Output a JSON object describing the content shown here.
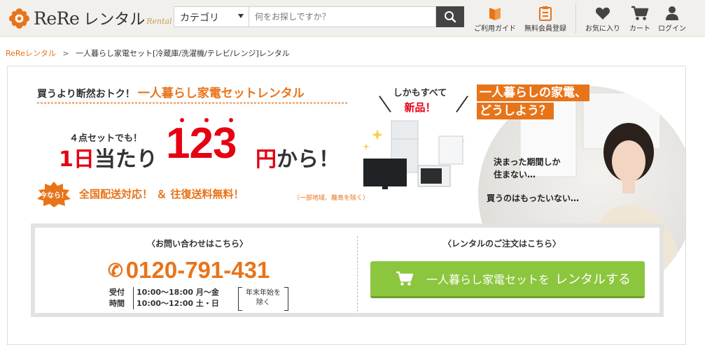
{
  "header": {
    "logo_text": "ReRe",
    "logo_text2": "レンタル",
    "logo_script": "Rental",
    "search": {
      "category_value": "カテゴリ",
      "placeholder": "何をお探しですか？"
    },
    "nav": [
      {
        "label": "ご利用ガイド",
        "icon": "guide-book-icon"
      },
      {
        "label": "無料会員登録",
        "icon": "clipboard-icon"
      },
      {
        "label": "お気に入り",
        "icon": "heart-icon"
      },
      {
        "label": "カート",
        "icon": "cart-icon"
      },
      {
        "label": "ログイン",
        "icon": "user-icon"
      }
    ]
  },
  "breadcrumb": {
    "home": "ReReレンタル",
    "separator": ">",
    "current": "一人暮らし家電セット[冷蔵庫/洗濯機/テレビ/レンジ]レンタル"
  },
  "hero": {
    "tagline": "買うより断然おトク！",
    "tagline_accent": "一人暮らし家電セットレンタル",
    "set_count": "４点セットでも！",
    "per_day_1": "1日",
    "per_day_2": "当たり",
    "price": "123",
    "yen": "円",
    "kara": "から！",
    "now_badge": "今なら！",
    "shipping": "全国配送対応！ ＆ 往復送料無料！",
    "shipping_note": "（一部地域、離島を除く）",
    "bubble_line1": "しかもすべて",
    "bubble_line2": "新品！",
    "question_line1": "一人暮らしの家電、",
    "question_line2": "どうしよう？",
    "worry_line1": "決まった期間しか",
    "worry_line2": "住まない…",
    "worry_line3": "買うのはもったいない…"
  },
  "contact": {
    "inquiry_heading": "〈お問い合わせはこちら〉",
    "phone": "0120-791-431",
    "hours_label1": "受付",
    "hours_label2": "時間",
    "hours_line1": "10:00〜18:00 月〜金",
    "hours_line2": "10:00〜12:00 土・日",
    "holiday_note1": "年末年始を",
    "holiday_note2": "除く",
    "order_heading": "〈レンタルのご注文はこちら〉",
    "button_text": "一人暮らし家電セットを",
    "button_text_big": "レンタルする"
  },
  "colors": {
    "accent_orange": "#e8741a",
    "price_red": "#e60012",
    "button_green": "#8cc63f"
  }
}
